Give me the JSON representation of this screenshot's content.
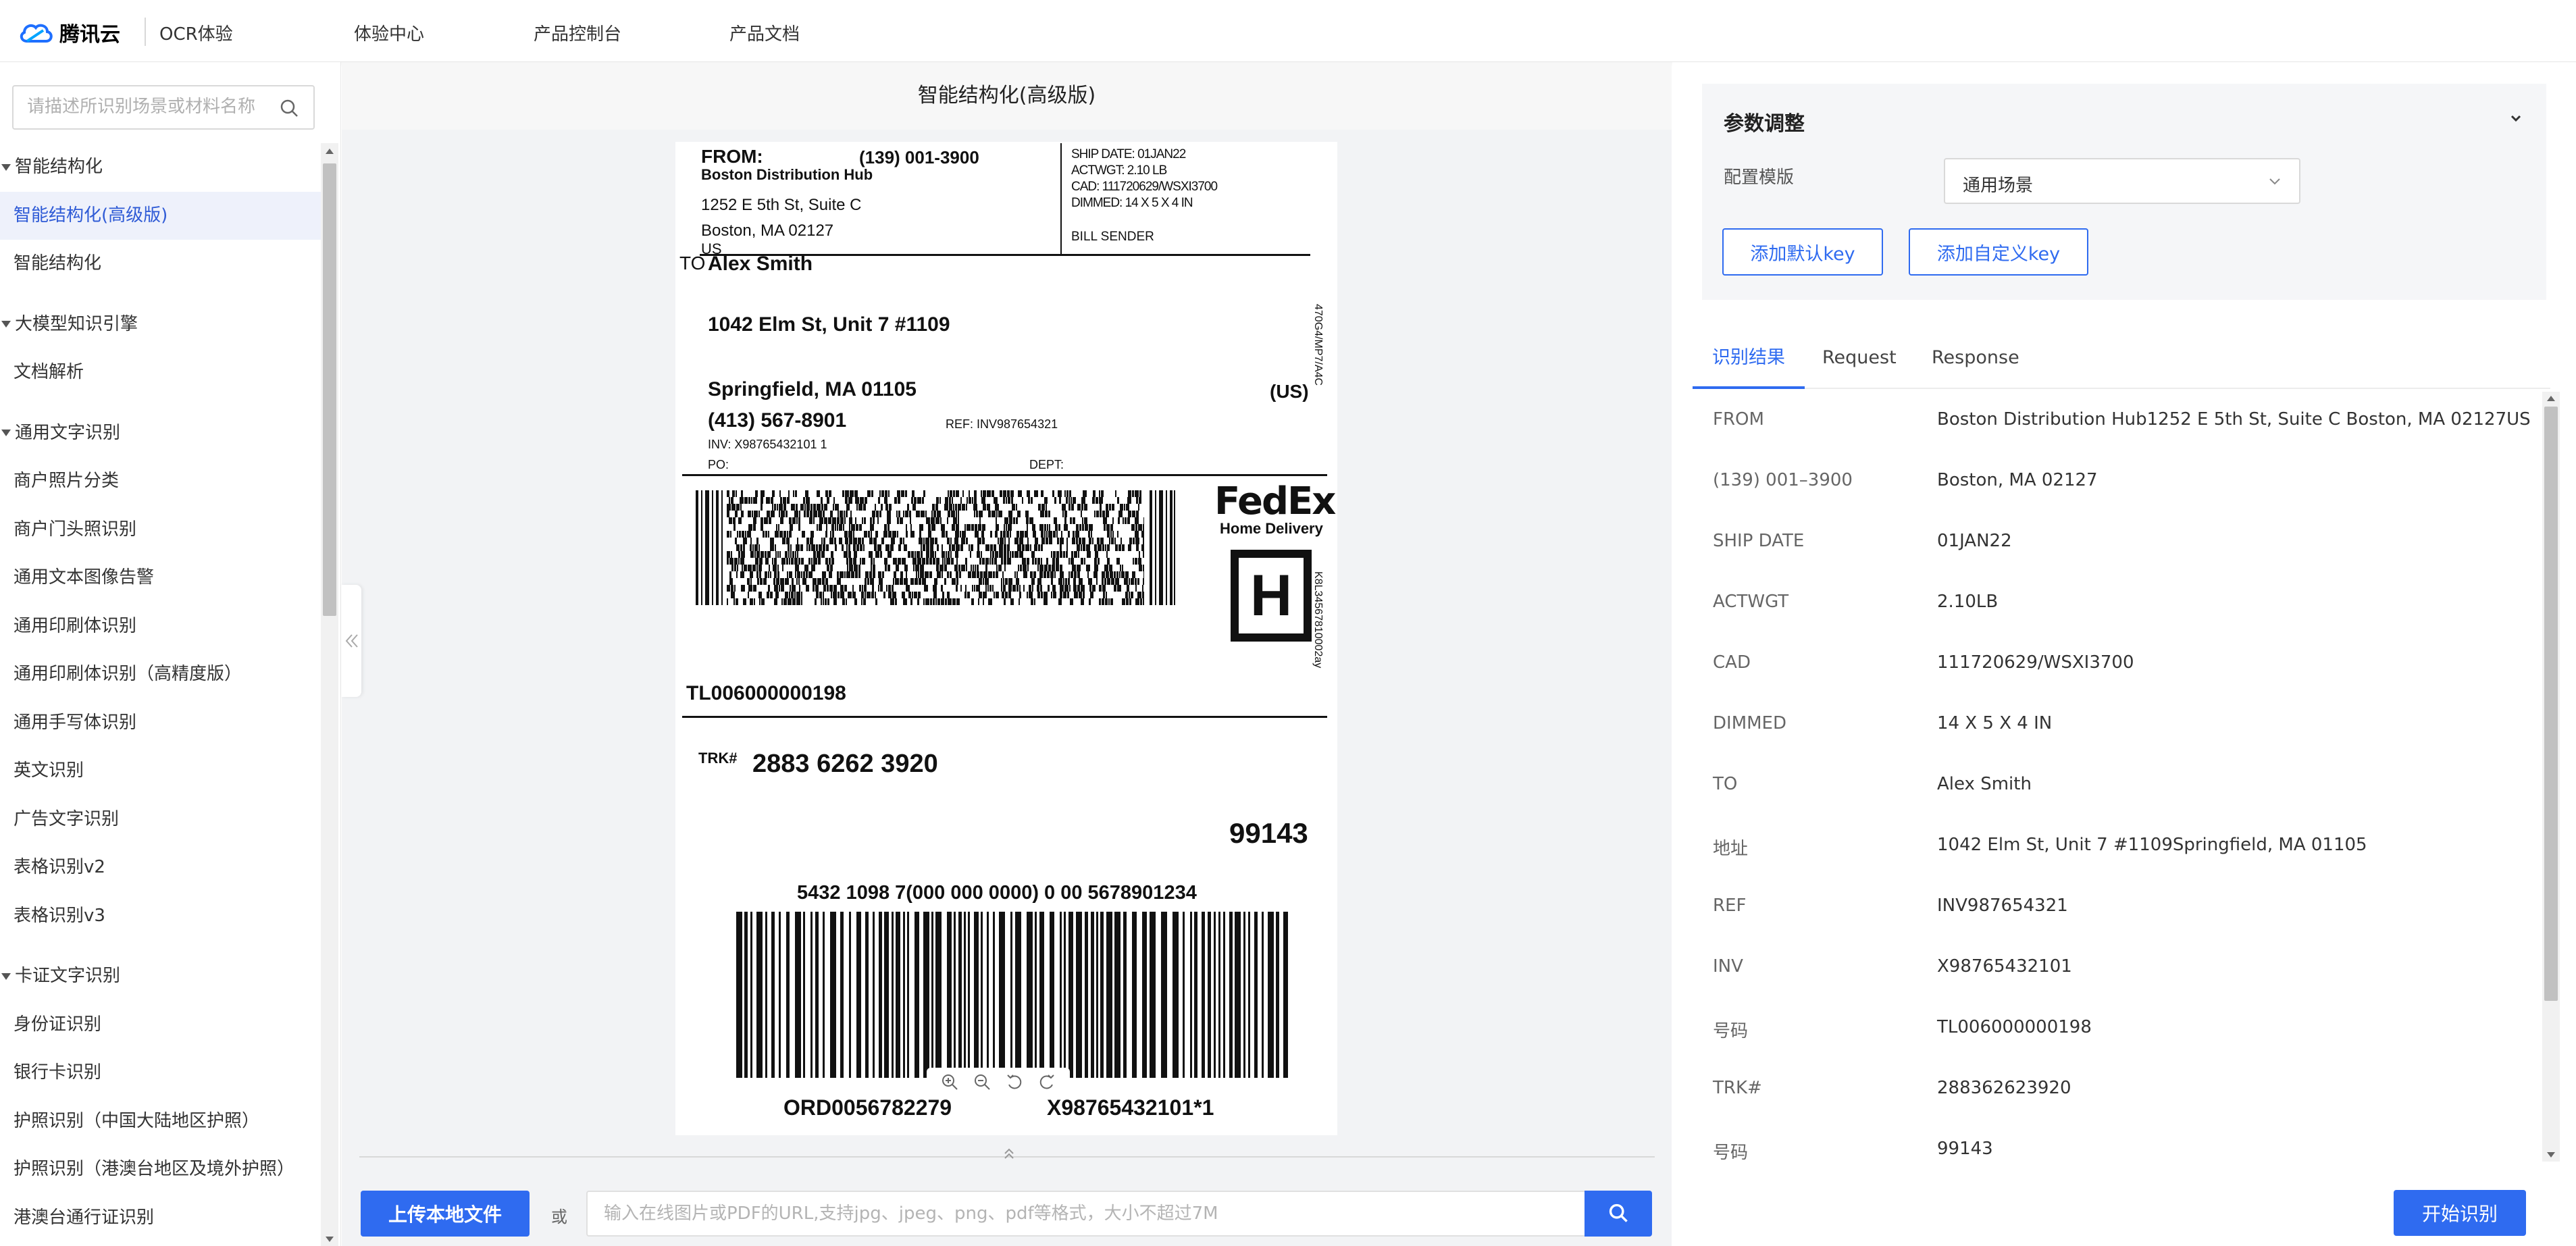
{
  "topbar": {
    "brand": "腾讯云",
    "product": "OCR体验",
    "nav": [
      "体验中心",
      "产品控制台",
      "产品文档"
    ]
  },
  "sidebar": {
    "search_placeholder": "请描述所识别场景或材料名称",
    "items": [
      {
        "label": "智能结构化",
        "type": "group"
      },
      {
        "label": "智能结构化(高级版)",
        "type": "item",
        "active": true
      },
      {
        "label": "智能结构化",
        "type": "item"
      },
      {
        "label": "大模型知识引擎",
        "type": "group"
      },
      {
        "label": "文档解析",
        "type": "item"
      },
      {
        "label": "通用文字识别",
        "type": "group"
      },
      {
        "label": "商户照片分类",
        "type": "item"
      },
      {
        "label": "商户门头照识别",
        "type": "item"
      },
      {
        "label": "通用文本图像告警",
        "type": "item"
      },
      {
        "label": "通用印刷体识别",
        "type": "item"
      },
      {
        "label": "通用印刷体识别（高精度版）",
        "type": "item"
      },
      {
        "label": "通用手写体识别",
        "type": "item"
      },
      {
        "label": "英文识别",
        "type": "item"
      },
      {
        "label": "广告文字识别",
        "type": "item"
      },
      {
        "label": "表格识别v2",
        "type": "item"
      },
      {
        "label": "表格识别v3",
        "type": "item"
      },
      {
        "label": "卡证文字识别",
        "type": "group"
      },
      {
        "label": "身份证识别",
        "type": "item"
      },
      {
        "label": "银行卡识别",
        "type": "item"
      },
      {
        "label": "护照识别（中国大陆地区护照）",
        "type": "item"
      },
      {
        "label": "护照识别（港澳台地区及境外护照）",
        "type": "item"
      },
      {
        "label": "港澳台通行证识别",
        "type": "item"
      }
    ]
  },
  "center": {
    "title": "智能结构化(高级版)",
    "upload_label": "上传本地文件",
    "or_label": "或",
    "url_placeholder": "输入在线图片或PDF的URL,支持jpg、jpeg、png、pdf等格式，大小不超过7M"
  },
  "label_doc": {
    "from_label": "FROM:",
    "from_phone": "(139) 001-3900",
    "from_name": "Boston Distribution Hub",
    "from_addr1": "1252 E 5th St, Suite C",
    "from_addr2": "Boston, MA 02127",
    "from_country": "US",
    "ship_date": "SHIP DATE: 01JAN22",
    "actwgt": "ACTWGT: 2.10 LB",
    "cad": "CAD: 111720629/WSXI3700",
    "dimmed": "DIMMED: 14 X 5 X 4 IN",
    "bill": "BILL SENDER",
    "to_label": "TO",
    "to_name": "Alex Smith",
    "to_addr1": "1042 Elm St, Unit 7 #1109",
    "to_addr2": "Springfield, MA 01105",
    "to_phone": "(413) 567-8901",
    "to_country": "(US)",
    "ref": "REF: INV987654321",
    "inv": "INV: X98765432101 1",
    "po": "PO:",
    "dept": "DEPT:",
    "side_code1": "470G4/MP7/A4C",
    "side_code2": "K8L34567810002ay",
    "fedex": "FedEx",
    "home_delivery": "Home Delivery",
    "h_mark": "H",
    "tl": "TL006000000198",
    "trk_label": "TRK#",
    "trk": "2883 6262 3920",
    "zip": "99143",
    "barcode_num": "5432 1098 7(000 000 0000) 0 00 5678901234",
    "ord": "ORD0056782279",
    "x_num": "X98765432101*1"
  },
  "right": {
    "params_title": "参数调整",
    "template_label": "配置模版",
    "template_value": "通用场景",
    "add_default_key": "添加默认key",
    "add_custom_key": "添加自定义key",
    "tabs": [
      "识别结果",
      "Request",
      "Response"
    ],
    "results": [
      {
        "k": "FROM",
        "v": "Boston Distribution Hub1252 E 5th St, Suite C Boston, MA 02127US"
      },
      {
        "k": "(139) 001–3900",
        "v": "Boston, MA 02127"
      },
      {
        "k": "SHIP DATE",
        "v": "01JAN22"
      },
      {
        "k": "ACTWGT",
        "v": "2.10LB"
      },
      {
        "k": "CAD",
        "v": "111720629/WSXI3700"
      },
      {
        "k": "DIMMED",
        "v": "14 X 5 X 4 IN"
      },
      {
        "k": "TO",
        "v": "Alex Smith"
      },
      {
        "k": "地址",
        "v": "1042 Elm St, Unit 7 #1109Springfield, MA 01105"
      },
      {
        "k": "REF",
        "v": "INV987654321"
      },
      {
        "k": "INV",
        "v": "X98765432101"
      },
      {
        "k": "号码",
        "v": "TL006000000198"
      },
      {
        "k": "TRK#",
        "v": "288362623920"
      },
      {
        "k": "号码",
        "v": "99143"
      }
    ],
    "start_label": "开始识别"
  },
  "colors": {
    "accent": "#2f6bf0",
    "active_bg": "#eef1fb",
    "active_text": "#2f5bd6"
  }
}
